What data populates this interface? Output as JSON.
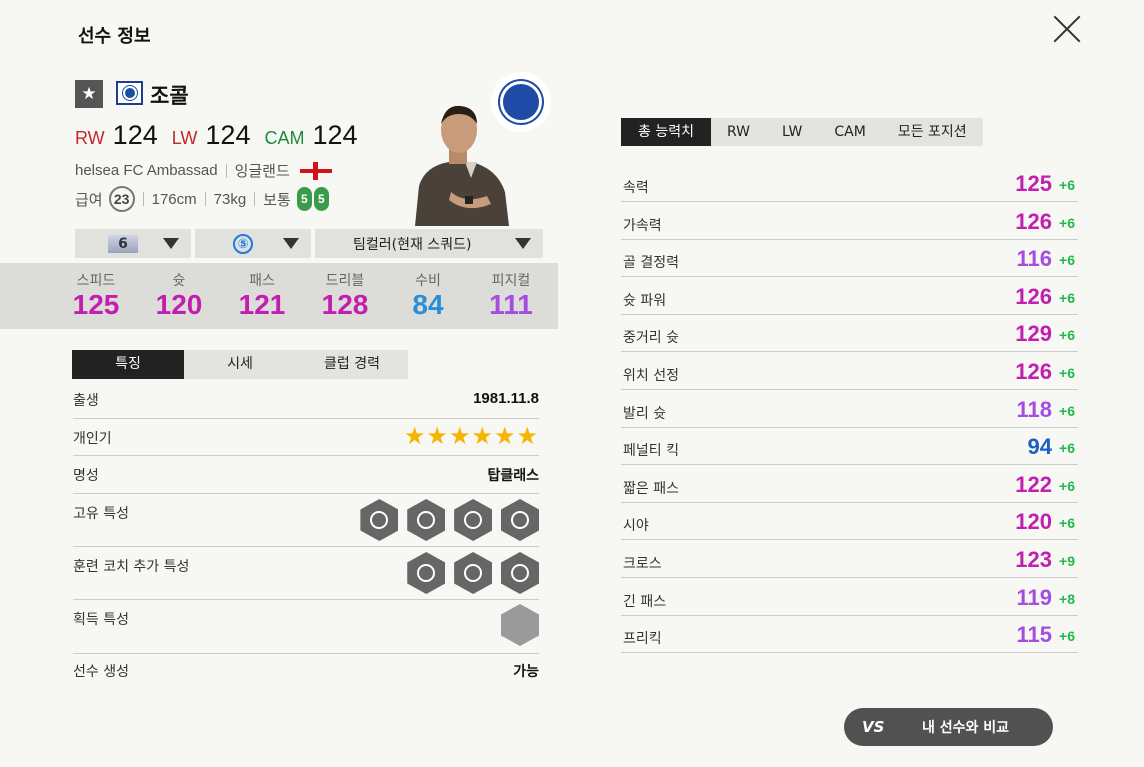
{
  "header": {
    "title": "선수 정보"
  },
  "player": {
    "star": "★",
    "name": "조콜",
    "positions": [
      {
        "label": "RW",
        "value": "124",
        "color": "#c0282d"
      },
      {
        "label": "LW",
        "value": "124",
        "color": "#c0282d"
      },
      {
        "label": "CAM",
        "value": "124",
        "color": "#1e8a3a"
      }
    ],
    "team": "helsea FC Ambassad",
    "nation": "잉글랜드",
    "salary_label": "급여",
    "salary": "23",
    "height": "176cm",
    "weight": "73kg",
    "body": "보통",
    "feet": [
      "5",
      "5"
    ]
  },
  "dropdowns": {
    "level": "6",
    "enhance": "⑤",
    "teamcolor": "팀컬러(현재 스쿼드)"
  },
  "stats": [
    {
      "label": "스피드",
      "value": "125",
      "color": "#c21fb0"
    },
    {
      "label": "슛",
      "value": "120",
      "color": "#c21fb0"
    },
    {
      "label": "패스",
      "value": "121",
      "color": "#c21fb0"
    },
    {
      "label": "드리블",
      "value": "128",
      "color": "#c21fb0"
    },
    {
      "label": "수비",
      "value": "84",
      "color": "#2a8ed6"
    },
    {
      "label": "피지컬",
      "value": "111",
      "color": "#a54de0"
    }
  ],
  "left_tabs": [
    "특징",
    "시세",
    "클럽 경력"
  ],
  "features": {
    "birth_label": "출생",
    "birth": "1981.11.8",
    "popularity_label": "개인기",
    "stars": "★★★★★★",
    "fame_label": "명성",
    "fame": "탑클래스",
    "unique_label": "고유 특성",
    "coach_label": "훈련 코치 추가 특성",
    "acquired_label": "획득 특성",
    "create_label": "선수 생성",
    "create": "가능"
  },
  "right_tabs": [
    "총 능력치",
    "RW",
    "LW",
    "CAM",
    "모든 포지션"
  ],
  "attributes": [
    {
      "label": "속력",
      "value": "125",
      "bonus": "+6",
      "color": "#c21fb0"
    },
    {
      "label": "가속력",
      "value": "126",
      "bonus": "+6",
      "color": "#c21fb0"
    },
    {
      "label": "골 결정력",
      "value": "116",
      "bonus": "+6",
      "color": "#a54de0"
    },
    {
      "label": "슛 파워",
      "value": "126",
      "bonus": "+6",
      "color": "#c21fb0"
    },
    {
      "label": "중거리 슛",
      "value": "129",
      "bonus": "+6",
      "color": "#c21fb0"
    },
    {
      "label": "위치 선정",
      "value": "126",
      "bonus": "+6",
      "color": "#c21fb0"
    },
    {
      "label": "발리 슛",
      "value": "118",
      "bonus": "+6",
      "color": "#a54de0"
    },
    {
      "label": "페널티 킥",
      "value": "94",
      "bonus": "+6",
      "color": "#1f5fc4"
    },
    {
      "label": "짧은 패스",
      "value": "122",
      "bonus": "+6",
      "color": "#c21fb0"
    },
    {
      "label": "시야",
      "value": "120",
      "bonus": "+6",
      "color": "#c21fb0"
    },
    {
      "label": "크로스",
      "value": "123",
      "bonus": "+9",
      "color": "#c21fb0"
    },
    {
      "label": "긴 패스",
      "value": "119",
      "bonus": "+8",
      "color": "#a54de0"
    },
    {
      "label": "프리킥",
      "value": "115",
      "bonus": "+6",
      "color": "#a54de0"
    }
  ],
  "compare_button": {
    "vs": "VS",
    "label": "내 선수와 비교"
  }
}
